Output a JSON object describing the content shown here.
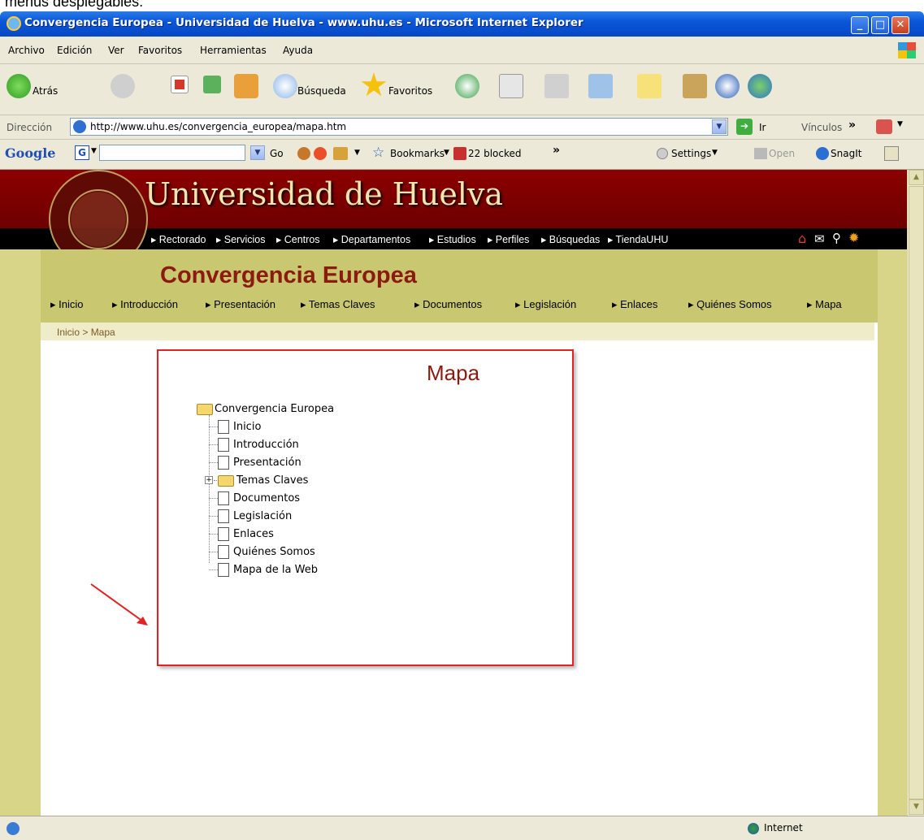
{
  "caption": "menús desplegables.",
  "window": {
    "title": "Convergencia Europea - Universidad de Huelva - www.uhu.es - Microsoft Internet Explorer",
    "minimize": "_",
    "maximize": "□",
    "close": "✕"
  },
  "menubar": [
    "Archivo",
    "Edición",
    "Ver",
    "Favoritos",
    "Herramientas",
    "Ayuda"
  ],
  "toolbar": {
    "back": "Atrás",
    "search": "Búsqueda",
    "favorites": "Favoritos"
  },
  "address": {
    "label": "Dirección",
    "url": "http://www.uhu.es/convergencia_europea/mapa.htm",
    "go": "Ir",
    "links": "Vínculos"
  },
  "google": {
    "logo": "Google",
    "go": "Go",
    "bookmarks": "Bookmarks",
    "blocked": "22 blocked",
    "settings": "Settings",
    "open": "Open",
    "snagit": "SnagIt"
  },
  "site": {
    "university": "Universidad de Huelva",
    "topnav": [
      "Rectorado",
      "Servicios",
      "Centros",
      "Departamentos",
      "Estudios",
      "Perfiles",
      "Búsquedas",
      "TiendaUHU"
    ],
    "section_title": "Convergencia Europea",
    "subnav": [
      "Inicio",
      "Introducción",
      "Presentación",
      "Temas Claves",
      "Documentos",
      "Legislación",
      "Enlaces",
      "Quiénes Somos",
      "Mapa"
    ],
    "breadcrumb": "Inicio > Mapa"
  },
  "map": {
    "title": "Mapa",
    "root": "Convergencia Europea",
    "items": [
      "Inicio",
      "Introducción",
      "Presentación",
      "Temas Claves",
      "Documentos",
      "Legislación",
      "Enlaces",
      "Quiénes Somos",
      "Mapa de la Web"
    ]
  },
  "status": {
    "zone": "Internet"
  },
  "colors": {
    "banner": "#8c0000",
    "olive": "#c9c770",
    "section_title": "#8b1a0f",
    "highlight": "#e02323"
  }
}
